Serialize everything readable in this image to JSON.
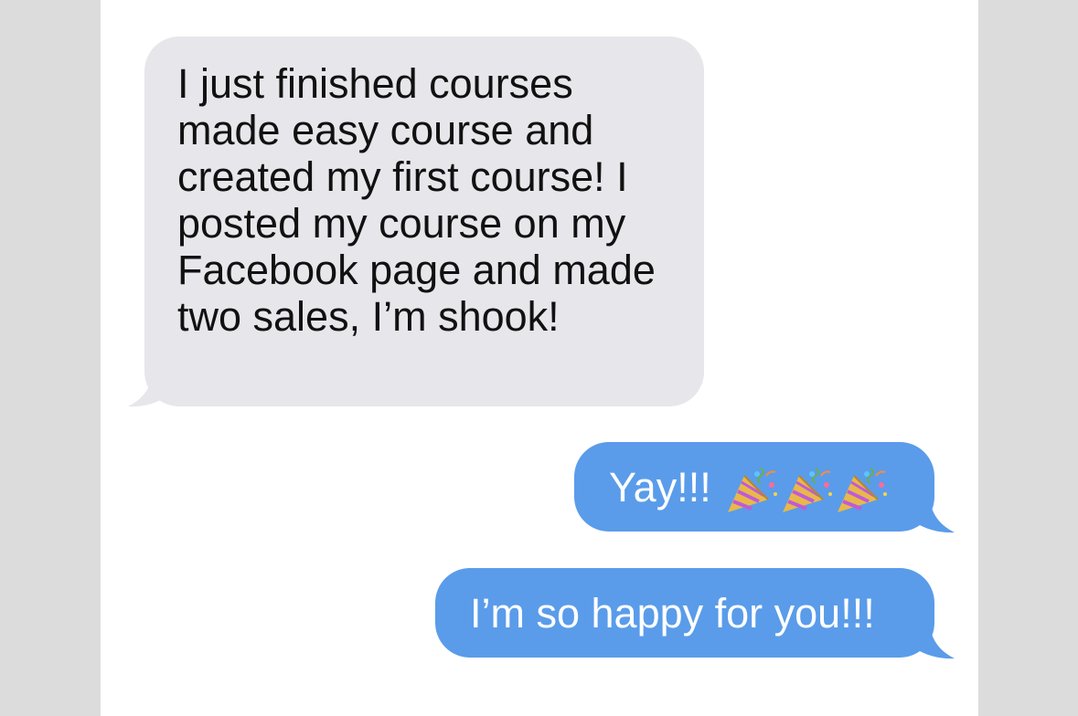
{
  "thread": {
    "messages": [
      {
        "direction": "received",
        "text": "I just finished courses made easy course and created my first course! I posted my course on my Facebook page and made two sales, I’m shook!"
      },
      {
        "direction": "sent",
        "text": "Yay!!!",
        "emoji": [
          "party-popper",
          "party-popper",
          "party-popper"
        ]
      },
      {
        "direction": "sent",
        "text": "I’m so happy for you!!!"
      }
    ]
  },
  "colors": {
    "received_bubble": "#e6e6eb",
    "sent_bubble": "#5a9cea",
    "background_side": "#dcdcdc",
    "thread_background": "#ffffff"
  }
}
